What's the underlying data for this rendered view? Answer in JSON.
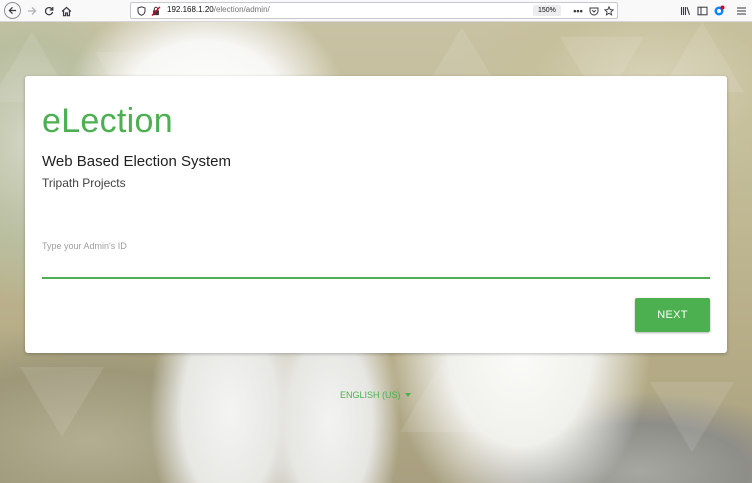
{
  "browser": {
    "url_host": "192.168.1.20",
    "url_path": "/election/admin/",
    "zoom": "150%",
    "page_actions": "•••"
  },
  "login": {
    "title": "eLection",
    "subtitle": "Web Based Election System",
    "org": "Tripath Projects",
    "admin_id_label": "Type your Admin's ID",
    "admin_id_value": "",
    "next_label": "NEXT"
  },
  "footer": {
    "language": "ENGLISH (US)"
  },
  "colors": {
    "accent": "#4caf50",
    "card": "#ffffff",
    "toolbar": "#f9f9fa"
  }
}
